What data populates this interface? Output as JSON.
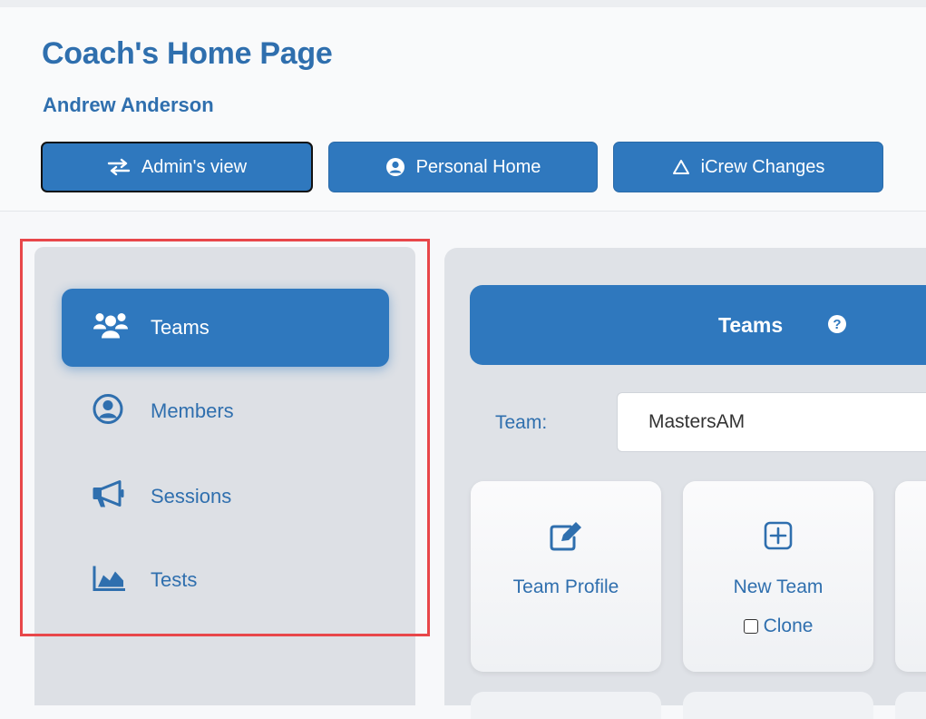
{
  "header": {
    "title": "Coach's Home Page",
    "user_name": "Andrew Anderson",
    "buttons": [
      {
        "label": "Admin's view",
        "icon": "swap-arrows-icon"
      },
      {
        "label": "Personal Home",
        "icon": "user-circle-icon"
      },
      {
        "label": "iCrew Changes",
        "icon": "triangle-icon"
      }
    ]
  },
  "sidebar": {
    "items": [
      {
        "label": "Teams",
        "icon": "users-group-icon",
        "active": true
      },
      {
        "label": "Members",
        "icon": "user-circle-icon",
        "active": false
      },
      {
        "label": "Sessions",
        "icon": "megaphone-icon",
        "active": false
      },
      {
        "label": "Tests",
        "icon": "area-chart-icon",
        "active": false
      }
    ]
  },
  "main": {
    "section_title": "Teams",
    "team_label": "Team:",
    "team_value": "MastersAM",
    "cards": [
      {
        "label": "Team Profile",
        "icon": "edit-icon"
      },
      {
        "label": "New Team",
        "icon": "plus-square-icon",
        "checkbox_label": "Clone",
        "checkbox_checked": false
      }
    ]
  },
  "colors": {
    "primary": "#2f78be",
    "text_blue": "#2f6fae",
    "highlight": "#e8474a"
  }
}
